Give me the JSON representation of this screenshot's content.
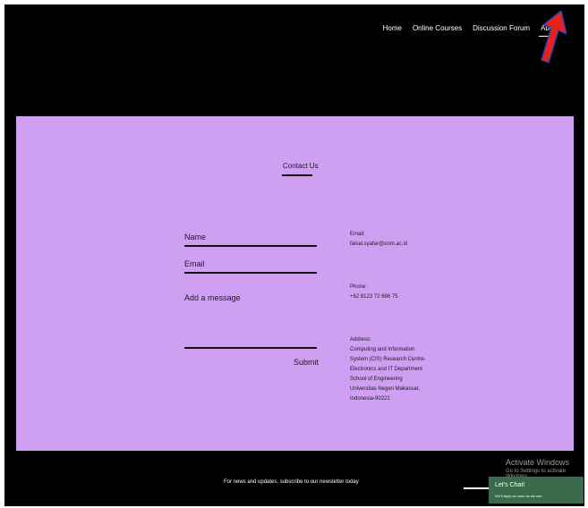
{
  "nav": {
    "items": [
      "Home",
      "Online Courses",
      "Discussion Forum",
      "About"
    ]
  },
  "contact": {
    "title": "Contact Us",
    "name_label": "Name",
    "email_label": "Email",
    "message_label": "Add a message",
    "submit_label": "Submit",
    "email_heading": "Email:",
    "email_value": "faisal.syafar@unm.ac.id",
    "phone_heading": "Phone:",
    "phone_value": "+62 8123 72 686 75",
    "address_heading": "Address:",
    "address_lines": [
      "Computing and Information",
      "System (CIS) Research Centre-",
      "Electronics and IT Department",
      "School of Engineering",
      "Universitas Negeri Makassar,",
      "Indonesia-90221"
    ]
  },
  "footer": {
    "newsletter_text": "For news and updates, subscribe to our newsletter today"
  },
  "overlay": {
    "activate_title": "Activate Windows",
    "activate_sub": "Go to Settings to activate Windows.",
    "chat_title": "Let's Chat!",
    "chat_sub": "We'll reply as soon as we can"
  },
  "colors": {
    "background": "#000000",
    "section": "#cf9ff2",
    "chat": "#3a6b4c",
    "arrow": "#e8211e"
  },
  "icons": {
    "pointer": "red-arrow-icon"
  }
}
